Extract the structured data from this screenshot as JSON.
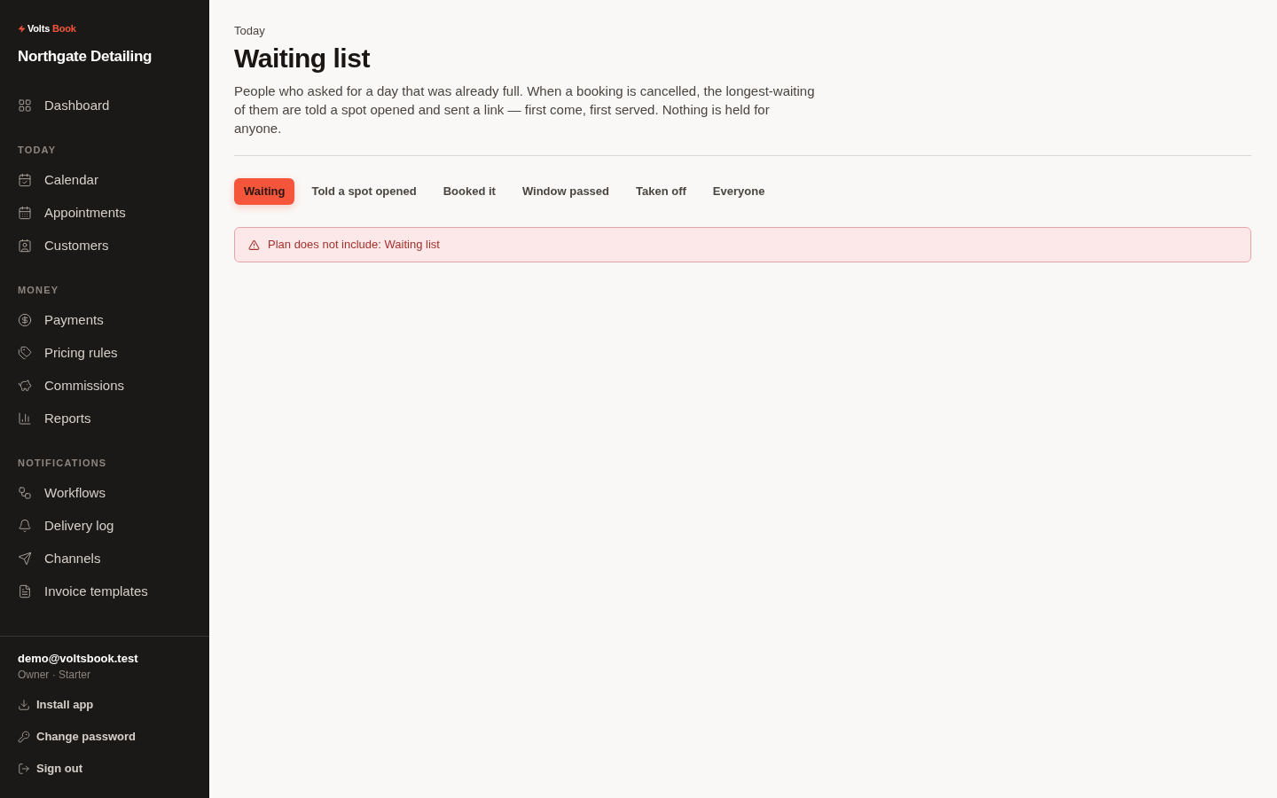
{
  "sidebar": {
    "logo_words": [
      "Volts",
      "Book"
    ],
    "business": "Northgate Detailing",
    "sections": [
      {
        "items": [
          {
            "label": "Dashboard",
            "selected": false
          }
        ]
      },
      {
        "heading": "TODAY",
        "items": [
          {
            "label": "Calendar",
            "selected": false
          },
          {
            "label": "Appointments",
            "selected": false
          },
          {
            "label": "Customers",
            "selected": false
          }
        ]
      },
      {
        "heading": "MONEY",
        "items": [
          {
            "label": "Payments",
            "selected": false
          },
          {
            "label": "Pricing rules",
            "selected": false
          },
          {
            "label": "Commissions",
            "selected": false
          },
          {
            "label": "Reports",
            "selected": false
          }
        ]
      },
      {
        "heading": "NOTIFICATIONS",
        "items": [
          {
            "label": "Workflows",
            "selected": false
          },
          {
            "label": "Delivery log",
            "selected": false
          },
          {
            "label": "Channels",
            "selected": false
          },
          {
            "label": "Invoice templates",
            "selected": false
          }
        ]
      }
    ],
    "account": {
      "email": "demo@voltsbook.test",
      "role": "Owner · Starter",
      "actions": [
        "Install app",
        "Change password",
        "Sign out"
      ]
    }
  },
  "page": {
    "eyebrow": "Today",
    "title": "Waiting list",
    "description": "People who asked for a day that was already full. When a booking is cancelled, the longest-waiting of them are told a spot opened and sent a link — first come, first served. Nothing is held for anyone.",
    "tabs": [
      {
        "label": "Waiting",
        "selected": true
      },
      {
        "label": "Told a spot opened",
        "selected": false
      },
      {
        "label": "Booked it",
        "selected": false
      },
      {
        "label": "Window passed",
        "selected": false
      },
      {
        "label": "Taken off",
        "selected": false
      },
      {
        "label": "Everyone",
        "selected": false
      }
    ],
    "alert": {
      "kind": "error",
      "message": "Plan does not include: Waiting list"
    }
  }
}
